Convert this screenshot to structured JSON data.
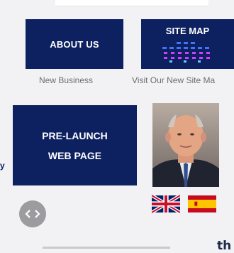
{
  "cards": {
    "about": {
      "label": "ABOUT US",
      "caption": "New Business"
    },
    "sitemap": {
      "title": "SITE MAP",
      "caption": "Visit Our New Site Ma"
    },
    "prelaunch": {
      "line1": "PRE-LAUNCH",
      "line2": "WEB PAGE"
    }
  },
  "side": {
    "mark": "y"
  },
  "footer": {
    "fragment": "th"
  },
  "colors": {
    "navy": "#0d2161",
    "caption": "#6b6b73",
    "page_bg": "#f2f2f4",
    "nav_button": "#9c9ca0"
  },
  "icons": {
    "nav": "left-right-arrows-icon",
    "uk_flag": "uk-flag-icon",
    "spain_flag": "spain-flag-icon"
  }
}
